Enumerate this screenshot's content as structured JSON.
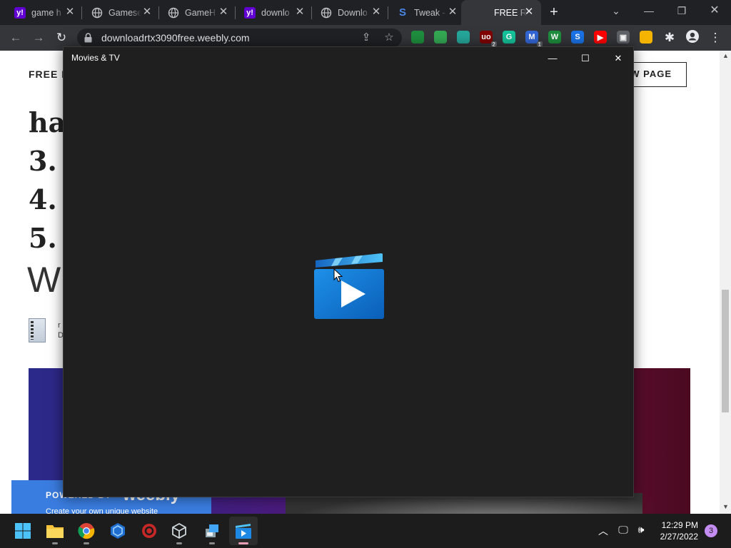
{
  "browser": {
    "tabs": [
      {
        "title": "game h",
        "favicon": "yahoo-icon",
        "active": false
      },
      {
        "title": "Gamese",
        "favicon": "globe-icon",
        "active": false
      },
      {
        "title": "GameH",
        "favicon": "globe-icon",
        "active": false
      },
      {
        "title": "downlo",
        "favicon": "yahoo-icon",
        "active": false
      },
      {
        "title": "Downlo",
        "favicon": "globe-icon",
        "active": false
      },
      {
        "title": "Tweak -",
        "favicon": "tweak-icon",
        "active": false
      },
      {
        "title": "FREE RT",
        "favicon": "none",
        "active": true
      }
    ],
    "new_tab_label": "+",
    "url": "downloadrtx3090free.weebly.com",
    "extensions": [
      {
        "name": "color-ext-icon",
        "label": "",
        "color": "#1e8e3e"
      },
      {
        "name": "shield-ext-icon",
        "label": "",
        "color": "#34a853"
      },
      {
        "name": "bird-ext-icon",
        "label": "",
        "color": "#26a69a"
      },
      {
        "name": "ublock-ext-icon",
        "label": "uo",
        "color": "#800000",
        "badge": "2"
      },
      {
        "name": "grammarly-ext-icon",
        "label": "G",
        "color": "#15c39a"
      },
      {
        "name": "mail-ext-icon",
        "label": "M",
        "color": "#3367d6",
        "badge": "1"
      },
      {
        "name": "w-ext-icon",
        "label": "W",
        "color": "#1e8e3e"
      },
      {
        "name": "s-ext-icon",
        "label": "S",
        "color": "#1a73e8"
      },
      {
        "name": "youtube-ext-icon",
        "label": "▶",
        "color": "#ff0000"
      },
      {
        "name": "screenshot-ext-icon",
        "label": "▣",
        "color": "#5f6368"
      },
      {
        "name": "globe-ext-icon",
        "label": "",
        "color": "#f4b400"
      }
    ]
  },
  "webpage": {
    "nav_text": "FREE R",
    "new_page_button": "W PAGE",
    "heading_lines": [
      "ha",
      "3.",
      "4.",
      "5."
    ],
    "w_text": "W",
    "file_text_lines": [
      "r",
      "D"
    ],
    "weebly_powered": "POWERED BY",
    "weebly_brand": "weebly",
    "weebly_create": "Create your own unique website"
  },
  "movies_app": {
    "title": "Movies & TV",
    "minimize": "—",
    "maximize": "☐",
    "close": "✕"
  },
  "taskbar": {
    "apps": [
      {
        "name": "start-button",
        "active": false
      },
      {
        "name": "file-explorer-icon",
        "active": false
      },
      {
        "name": "chrome-icon",
        "active": false
      },
      {
        "name": "virtualbox-icon",
        "active": false
      },
      {
        "name": "red-app-icon",
        "active": false
      },
      {
        "name": "cube-app-icon",
        "active": false
      },
      {
        "name": "installer-icon",
        "active": false
      },
      {
        "name": "movies-tv-icon",
        "active": true
      }
    ],
    "time": "12:29 PM",
    "date": "2/27/2022",
    "notification_count": "3"
  },
  "colors": {
    "browser_frame": "#202124",
    "toolbar": "#35363a",
    "app_background": "#1f1f1f",
    "accent_blue": "#1e90e8"
  }
}
